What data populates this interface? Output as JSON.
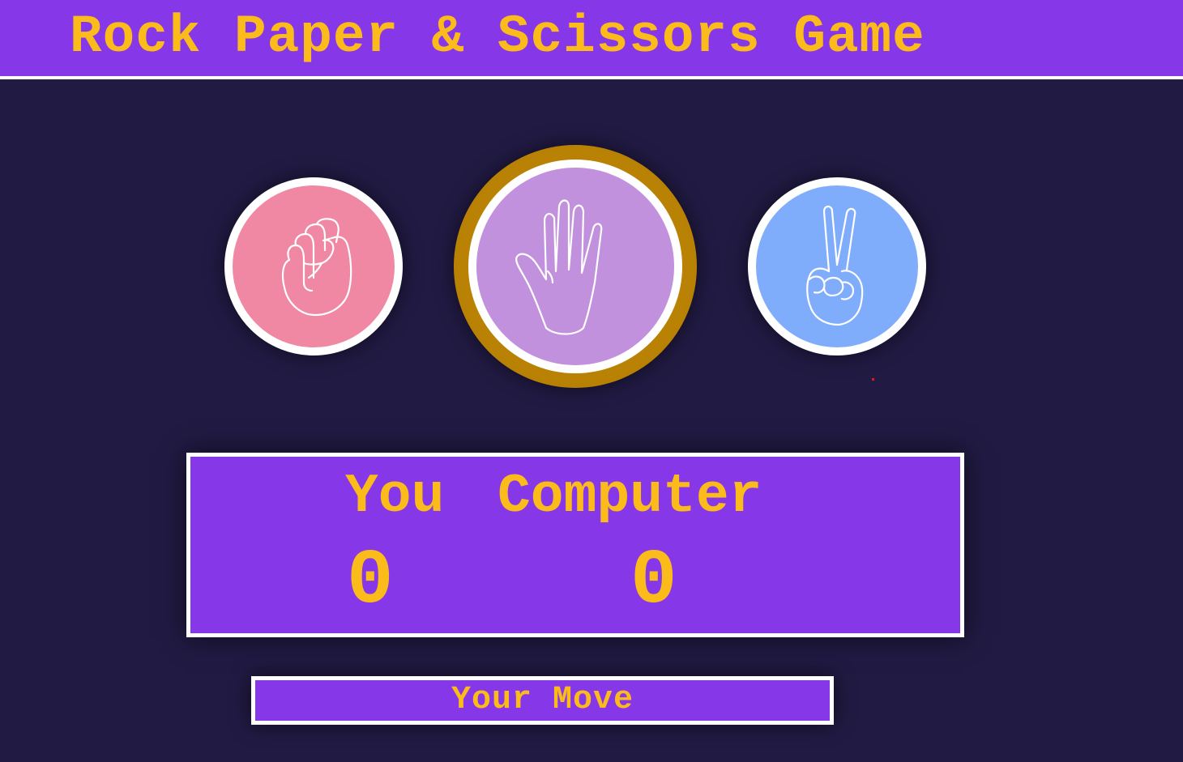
{
  "header": {
    "title": "Rock Paper & Scissors Game"
  },
  "choices": [
    {
      "id": "rock",
      "icon": "fist-icon",
      "color": "#f087a3"
    },
    {
      "id": "paper",
      "icon": "open-hand-icon",
      "color": "#c291dd",
      "highlighted": true,
      "highlight_color": "#c88f05"
    },
    {
      "id": "scissors",
      "icon": "peace-hand-icon",
      "color": "#7fadfb"
    }
  ],
  "scoreboard": {
    "you_label": "You",
    "computer_label": "Computer",
    "you_score": "0",
    "computer_score": "0"
  },
  "message": {
    "text": "Your Move"
  },
  "colors": {
    "background": "#211a43",
    "accent": "#8637e8",
    "text": "#fbbb1b",
    "border": "#ffffff"
  }
}
